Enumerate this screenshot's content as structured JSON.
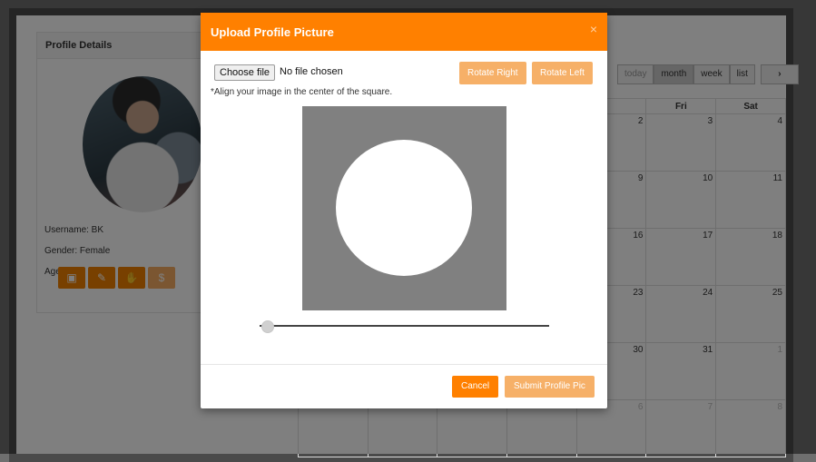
{
  "background": {
    "panel": {
      "title": "Profile Details",
      "username": "Username: BK",
      "gender": "Gender: Female",
      "age": "Age: 21",
      "icons": [
        "image-icon",
        "pencil-icon",
        "thumbs-down-icon",
        "dollar-icon"
      ]
    },
    "calendar": {
      "buttons": {
        "today": "today",
        "month": "month",
        "week": "week",
        "list": "list",
        "next": "›"
      },
      "visible_headers": [
        "Fri",
        "Sat"
      ],
      "rows": [
        [
          "",
          "",
          "",
          "",
          "2",
          "3",
          "4"
        ],
        [
          "",
          "",
          "",
          "",
          "9",
          "10",
          "11"
        ],
        [
          "",
          "",
          "",
          "",
          "16",
          "17",
          "18"
        ],
        [
          "",
          "",
          "",
          "",
          "23",
          "24",
          "25"
        ],
        [
          "",
          "",
          "",
          "",
          "30",
          "31",
          "1"
        ],
        [
          "",
          "",
          "",
          "",
          "6",
          "7",
          "8"
        ]
      ]
    }
  },
  "modal": {
    "title": "Upload Profile Picture",
    "close_label": "×",
    "file_button": "Choose file",
    "file_status": "No file chosen",
    "hint": "*Align your image in the center of the square.",
    "rotate_right": "Rotate Right",
    "rotate_left": "Rotate Left",
    "zoom_level": 0,
    "cancel": "Cancel",
    "submit": "Submit Profile Pic"
  },
  "colors": {
    "accent": "#ff8000",
    "accent_light": "#f6b068",
    "crop_bg": "#808080"
  }
}
